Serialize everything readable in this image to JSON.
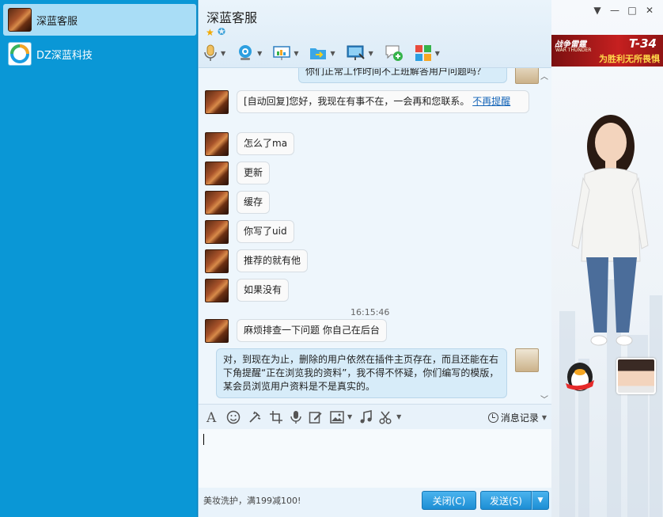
{
  "conversations": [
    {
      "name": "深蓝客服",
      "active": true
    },
    {
      "name": "DZ深蓝科技",
      "active": false
    }
  ],
  "chat": {
    "title": "深蓝客服",
    "messages": [
      {
        "from": "me",
        "text": "你们正常工作时间不上班解答用户问题吗？"
      },
      {
        "from": "them",
        "text": "[自动回复]您好，我现在有事不在，一会再和您联系。",
        "link": "不再提醒"
      },
      {
        "from": "them",
        "text": "怎么了ma"
      },
      {
        "from": "them",
        "text": "更新"
      },
      {
        "from": "them",
        "text": "缓存"
      },
      {
        "from": "them",
        "text": "你写了uid"
      },
      {
        "from": "them",
        "text": "推荐的就有他"
      },
      {
        "from": "them",
        "text": "如果没有"
      },
      {
        "from": "them",
        "text": "麻烦排查一下问题 你自己在后台"
      },
      {
        "from": "me",
        "text": "对，到现在为止，删除的用户依然在插件主页存在，而且还能在右下角提醒“正在浏览我的资料”，我不得不怀疑，你们编写的模版，某会员浏览用户资料是不是真实的。"
      }
    ],
    "timestamp": "16:15:46"
  },
  "input_tools": {
    "history_label": "消息记录"
  },
  "footer": {
    "ad_text": "美妆洗护，满199减100!",
    "close_label": "关闭(C)",
    "send_label": "发送(S)"
  },
  "banner": {
    "game_cn": "战争雷霆",
    "game_en": "WAR THUNDER",
    "tank": "T-34",
    "slogan": "为胜利无所畏惧"
  },
  "colors": {
    "sidebar": "#0a97d6",
    "accent": "#1d8ed4",
    "bubble_mine": "#d7ecf9"
  }
}
